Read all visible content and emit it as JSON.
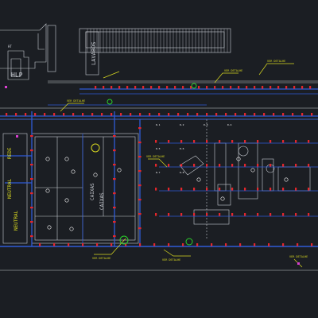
{
  "drawing": {
    "background": "#1b1e23",
    "colors": {
      "structure": "#c8ccd2",
      "pipe": "#2f5bd8",
      "valve": "#e5262b",
      "callout": "#d8d820",
      "highlight": "#2bd12b",
      "device": "#ffffff",
      "magenta": "#d93fd0"
    }
  },
  "labels": {
    "lavabos": "LAVABOS",
    "hlp": "HLP",
    "ht": "HT",
    "neutral_left": "NEUTRAL",
    "neutral_right": "NEUTRAL",
    "rede": "REDE",
    "caixas_1": "CAIXAS",
    "caixas_2": "CAIXAS"
  },
  "callouts": {
    "top_right": "VER DETALHE",
    "top_mid": "VER DETALHE",
    "top_left": "VER DETALHE",
    "right_mid": "VER DETALHE",
    "bottom_mid": "VER DETALHE",
    "bottom_left": "VER DETALHE",
    "bottom_right": "VER DETALHE"
  },
  "valve_codes": [
    "D-1",
    "D-2",
    "D-3",
    "D-4",
    "D-5",
    "D-6",
    "D-7",
    "D-8"
  ]
}
